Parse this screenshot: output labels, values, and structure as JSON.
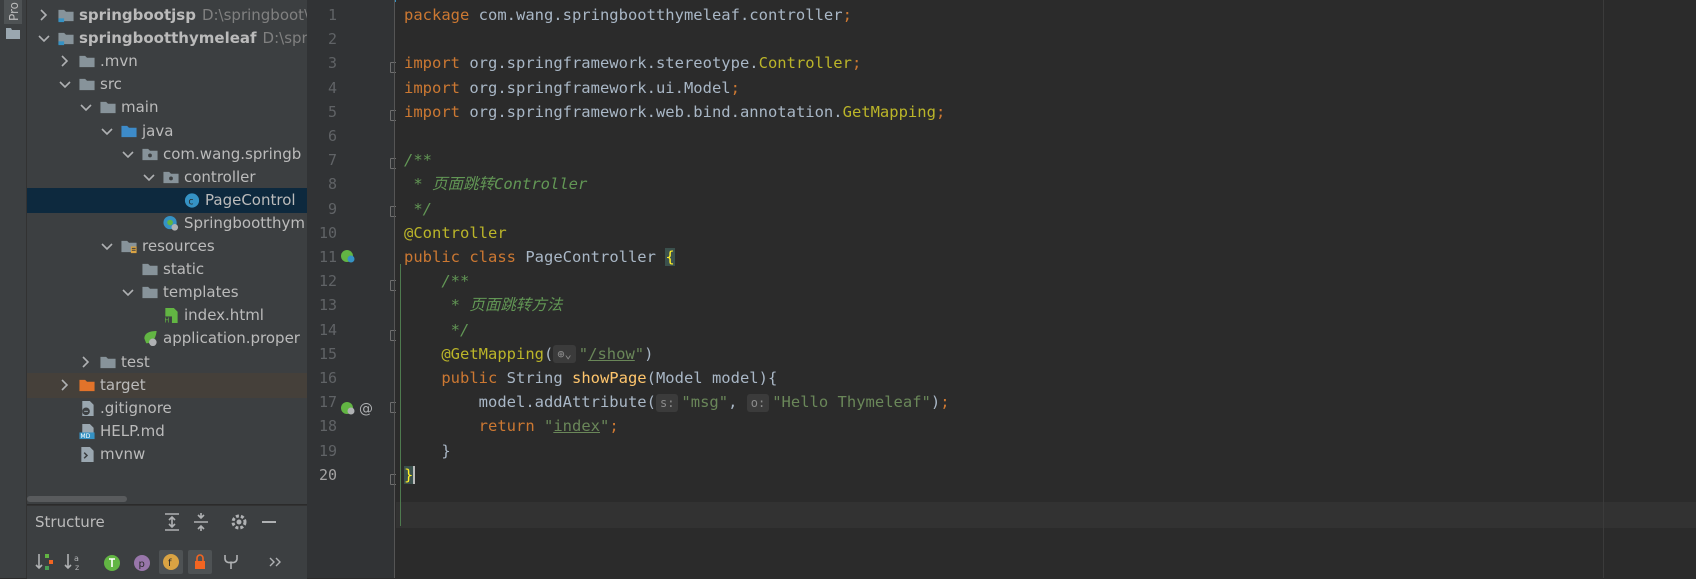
{
  "side_tab": {
    "label": "Pro"
  },
  "project_tree": [
    {
      "label": "springbootjsp",
      "path": "D:\\springboot\\s",
      "bold": true,
      "depth": 0,
      "arrow": "right",
      "icon": "module-folder"
    },
    {
      "label": "springbootthymeleaf",
      "path": "D:\\spring",
      "bold": true,
      "depth": 0,
      "arrow": "down",
      "icon": "module-folder"
    },
    {
      "label": ".mvn",
      "depth": 1,
      "arrow": "right",
      "icon": "folder"
    },
    {
      "label": "src",
      "depth": 1,
      "arrow": "down",
      "icon": "folder"
    },
    {
      "label": "main",
      "depth": 2,
      "arrow": "down",
      "icon": "folder"
    },
    {
      "label": "java",
      "depth": 3,
      "arrow": "down",
      "icon": "source-folder"
    },
    {
      "label": "com.wang.springb",
      "depth": 4,
      "arrow": "down",
      "icon": "package"
    },
    {
      "label": "controller",
      "depth": 5,
      "arrow": "down",
      "icon": "package"
    },
    {
      "label": "PageControl",
      "depth": 6,
      "arrow": "none",
      "icon": "class",
      "selected": true
    },
    {
      "label": "Springbootthym",
      "depth": 5,
      "arrow": "none",
      "icon": "spring-app"
    },
    {
      "label": "resources",
      "depth": 3,
      "arrow": "down",
      "icon": "resources-folder"
    },
    {
      "label": "static",
      "depth": 4,
      "arrow": "none",
      "icon": "folder"
    },
    {
      "label": "templates",
      "depth": 4,
      "arrow": "down",
      "icon": "folder"
    },
    {
      "label": "index.html",
      "depth": 5,
      "arrow": "none",
      "icon": "html-file"
    },
    {
      "label": "application.proper",
      "depth": 4,
      "arrow": "none",
      "icon": "spring-properties"
    },
    {
      "label": "test",
      "depth": 2,
      "arrow": "right",
      "icon": "folder"
    },
    {
      "label": "target",
      "depth": 1,
      "arrow": "right",
      "icon": "excluded-folder",
      "excluded": true
    },
    {
      "label": ".gitignore",
      "depth": 1,
      "arrow": "none",
      "icon": "gitignore-file"
    },
    {
      "label": "HELP.md",
      "depth": 1,
      "arrow": "none",
      "icon": "markdown-file"
    },
    {
      "label": "mvnw",
      "depth": 1,
      "arrow": "none",
      "icon": "shell-file"
    }
  ],
  "structure": {
    "title": "Structure",
    "header_icons": [
      "expand-all-icon",
      "collapse-all-icon",
      "gear-icon",
      "minimize-icon"
    ],
    "toolbar_icons": [
      "sort-by-visibility-icon",
      "sort-alphabetically-icon",
      "show-inherited-icon",
      "show-properties-icon",
      "show-fields-icon",
      "show-non-public-icon",
      "show-lambdas-icon",
      "more-icon"
    ]
  },
  "editor": {
    "current_line": 20,
    "line_numbers": [
      "1",
      "2",
      "3",
      "4",
      "5",
      "6",
      "7",
      "8",
      "9",
      "10",
      "11",
      "12",
      "13",
      "14",
      "15",
      "16",
      "17",
      "18",
      "19",
      "20"
    ],
    "lines": [
      [
        [
          "kw",
          "package "
        ],
        [
          "plain",
          "com.wang.springbootthymeleaf.controller"
        ],
        [
          "kw",
          ";"
        ]
      ],
      [],
      [
        [
          "kw",
          "import "
        ],
        [
          "plain",
          "org.springframework.stereotype."
        ],
        [
          "ann",
          "Controller"
        ],
        [
          "kw",
          ";"
        ]
      ],
      [
        [
          "kw",
          "import "
        ],
        [
          "plain",
          "org.springframework.ui.Model"
        ],
        [
          "kw",
          ";"
        ]
      ],
      [
        [
          "kw",
          "import "
        ],
        [
          "plain",
          "org.springframework.web.bind.annotation."
        ],
        [
          "ann",
          "GetMapping"
        ],
        [
          "kw",
          ";"
        ]
      ],
      [],
      [
        [
          "cmt",
          "/**"
        ]
      ],
      [
        [
          "cmt",
          " * 页面跳转Controller"
        ]
      ],
      [
        [
          "cmt",
          " */"
        ]
      ],
      [
        [
          "ann",
          "@Controller"
        ]
      ],
      [
        [
          "kw",
          "public class "
        ],
        [
          "plain",
          "PageController "
        ],
        [
          "brace",
          "{"
        ]
      ],
      [
        [
          "plain",
          "    "
        ],
        [
          "cmt",
          "/**"
        ]
      ],
      [
        [
          "plain",
          "     "
        ],
        [
          "cmt",
          "* 页面跳转方法"
        ]
      ],
      [
        [
          "plain",
          "     "
        ],
        [
          "cmt",
          "*/"
        ]
      ],
      [
        [
          "plain",
          "    "
        ],
        [
          "ann",
          "@GetMapping"
        ],
        [
          "plain",
          "("
        ],
        [
          "hint",
          "⊕⌄"
        ],
        [
          "str",
          "\""
        ],
        [
          "strU",
          "/show"
        ],
        [
          "str",
          "\""
        ],
        [
          "plain",
          ")"
        ]
      ],
      [
        [
          "plain",
          "    "
        ],
        [
          "kw",
          "public "
        ],
        [
          "plain",
          "String "
        ],
        [
          "fn",
          "showPage"
        ],
        [
          "plain",
          "(Model model){"
        ]
      ],
      [
        [
          "plain",
          "        model.addAttribute("
        ],
        [
          "hint",
          "s:"
        ],
        [
          "str",
          "\"msg\""
        ],
        [
          "plain",
          ", "
        ],
        [
          "hint",
          "o:"
        ],
        [
          "str",
          "\"Hello Thymeleaf\""
        ],
        [
          "plain",
          ")"
        ],
        [
          "kw",
          ";"
        ]
      ],
      [
        [
          "plain",
          "        "
        ],
        [
          "kw",
          "return "
        ],
        [
          "str",
          "\""
        ],
        [
          "strU",
          "index"
        ],
        [
          "str",
          "\""
        ],
        [
          "kw",
          ";"
        ]
      ],
      [
        [
          "plain",
          "    }"
        ]
      ],
      [
        [
          "brace",
          "}"
        ],
        [
          "caret",
          ""
        ]
      ]
    ]
  }
}
